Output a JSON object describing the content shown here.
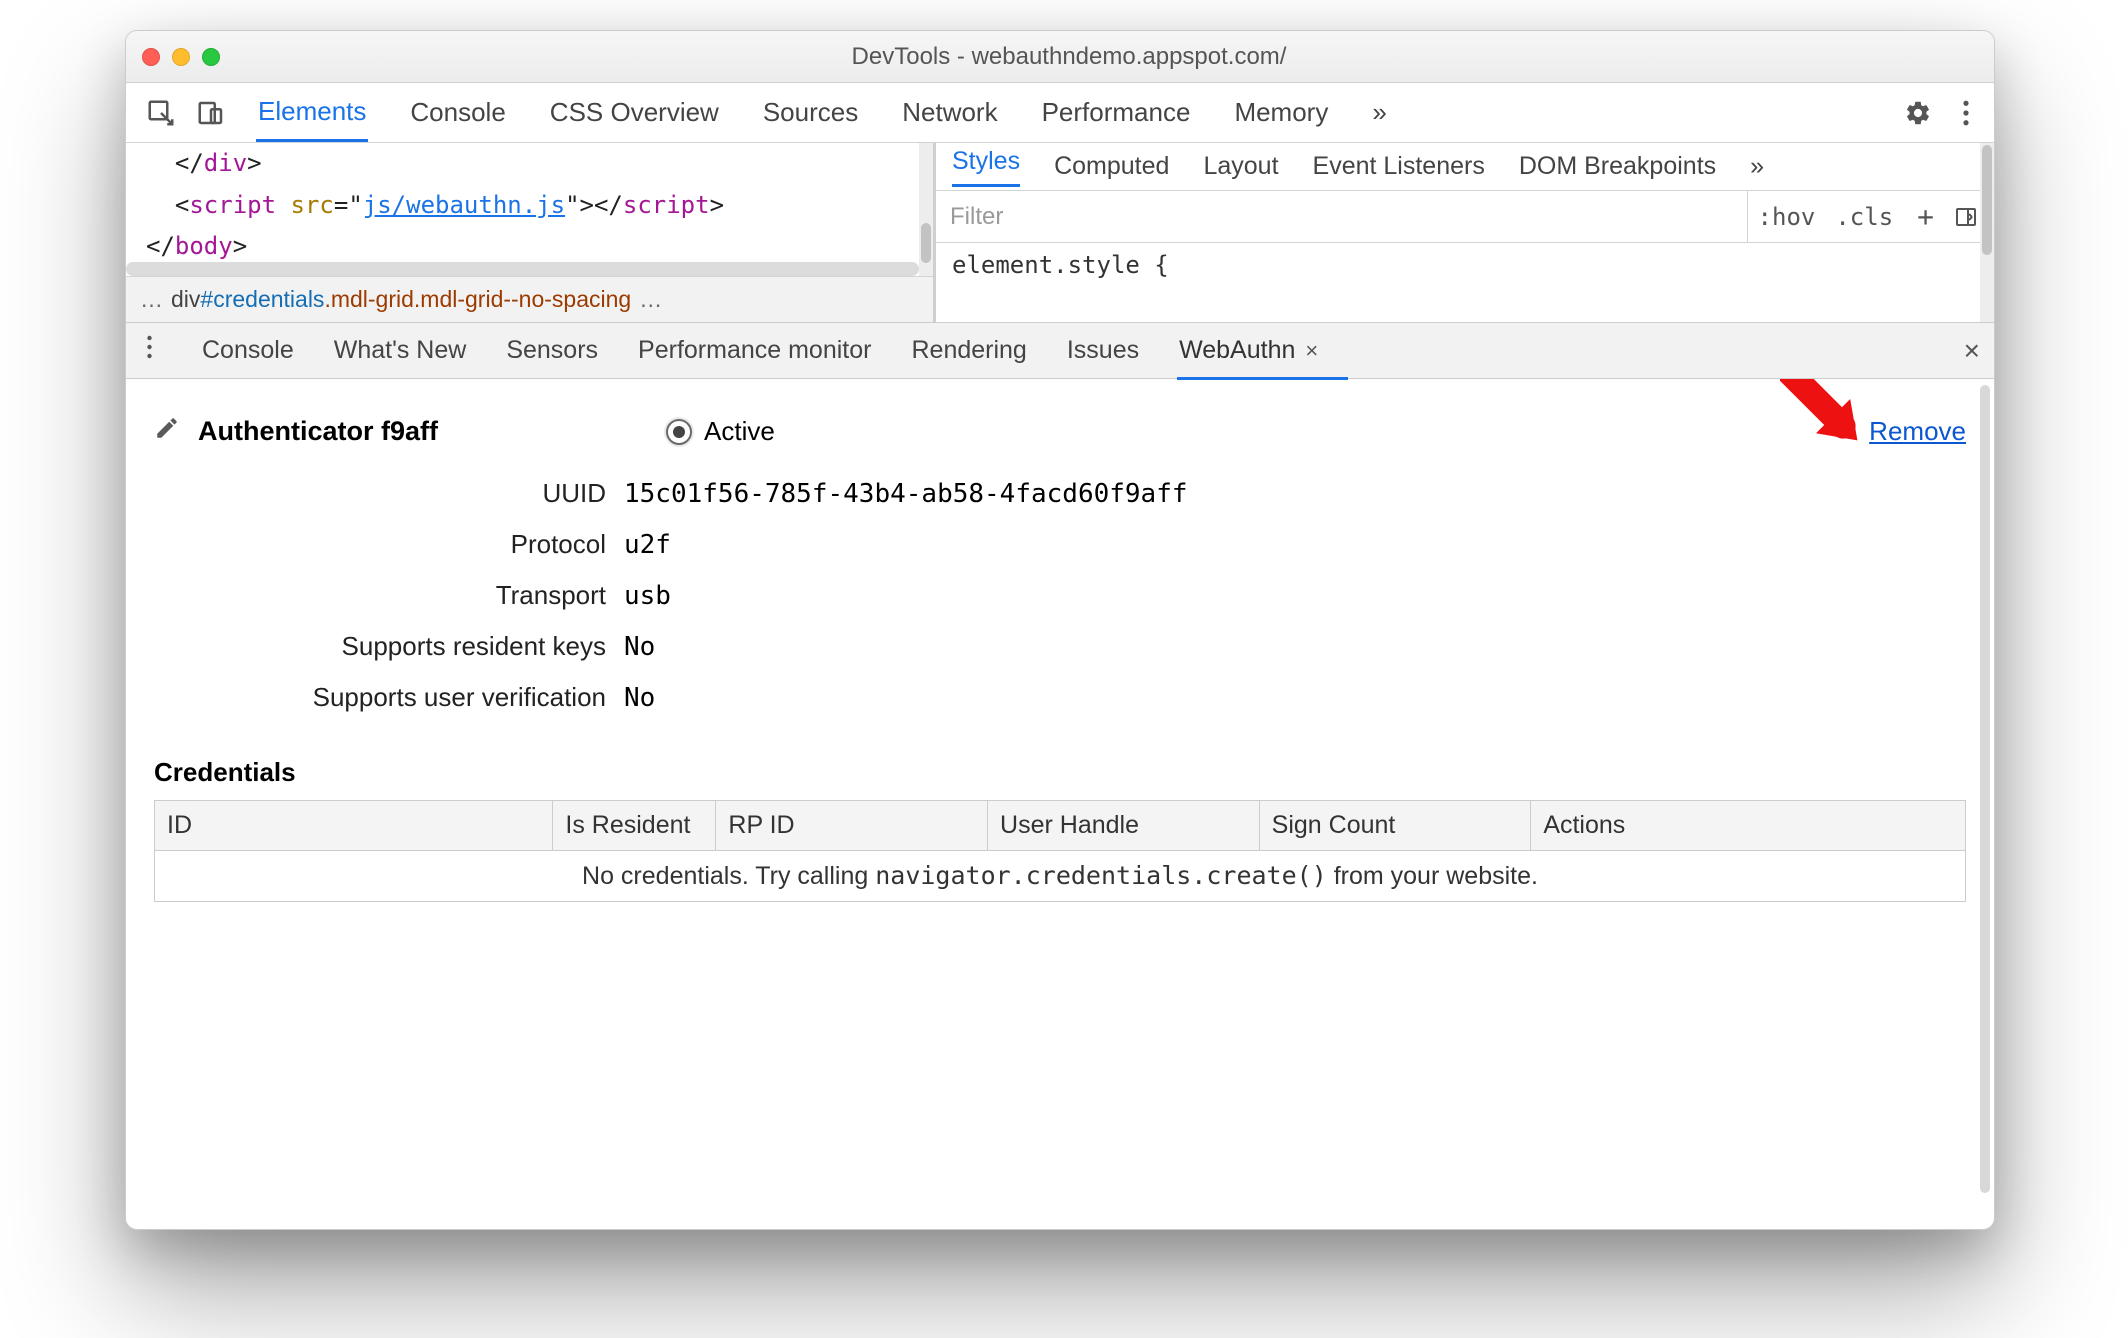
{
  "window": {
    "title": "DevTools - webauthndemo.appspot.com/"
  },
  "main_tabs": {
    "items": [
      "Elements",
      "Console",
      "CSS Overview",
      "Sources",
      "Network",
      "Performance",
      "Memory"
    ],
    "more_glyph": "»",
    "active_index": 0
  },
  "elements": {
    "code_lines": [
      {
        "indent": 1,
        "raw": "</div>"
      },
      {
        "indent": 1,
        "raw_script": true,
        "attr": "src",
        "val": "js/webauthn.js"
      },
      {
        "indent": 1,
        "raw": "</body>"
      }
    ],
    "breadcrumb": {
      "lead": "…",
      "tag": "div",
      "id": "#credentials",
      "cls": ".mdl-grid.mdl-grid--no-spacing",
      "trail": "…"
    }
  },
  "styles": {
    "tabs": [
      "Styles",
      "Computed",
      "Layout",
      "Event Listeners",
      "DOM Breakpoints"
    ],
    "more_glyph": "»",
    "filter_placeholder": "Filter",
    "hov": ":hov",
    "cls": ".cls",
    "plus": "+",
    "element_style": "element.style {"
  },
  "drawer": {
    "tabs": [
      "Console",
      "What's New",
      "Sensors",
      "Performance monitor",
      "Rendering",
      "Issues",
      "WebAuthn"
    ],
    "active_index": 6
  },
  "webauthn": {
    "title": "Authenticator f9aff",
    "active_label": "Active",
    "remove_label": "Remove",
    "props": [
      {
        "label": "UUID",
        "value": "15c01f56-785f-43b4-ab58-4facd60f9aff"
      },
      {
        "label": "Protocol",
        "value": "u2f"
      },
      {
        "label": "Transport",
        "value": "usb"
      },
      {
        "label": "Supports resident keys",
        "value": "No"
      },
      {
        "label": "Supports user verification",
        "value": "No"
      }
    ],
    "credentials_heading": "Credentials",
    "columns": [
      "ID",
      "Is Resident",
      "RP ID",
      "User Handle",
      "Sign Count",
      "Actions"
    ],
    "empty_prefix": "No credentials. Try calling ",
    "empty_code": "navigator.credentials.create()",
    "empty_suffix": " from your website."
  }
}
